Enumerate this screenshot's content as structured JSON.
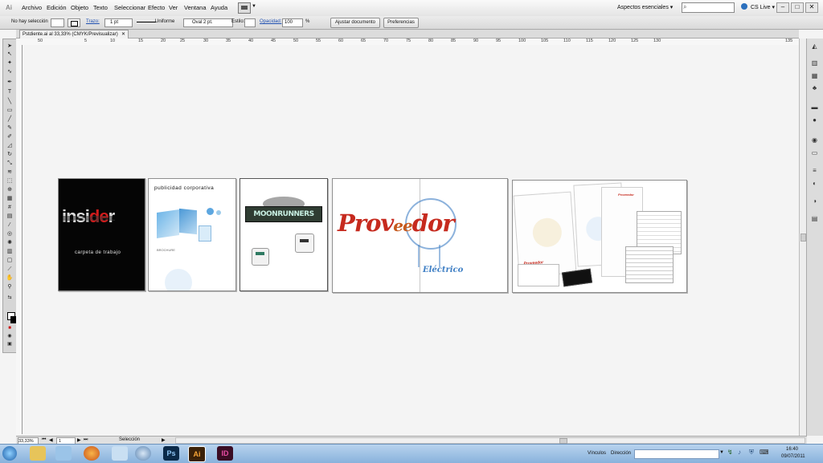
{
  "menubar": {
    "app_logo": "Ai",
    "menus": [
      "Archivo",
      "Edición",
      "Objeto",
      "Texto",
      "Seleccionar",
      "Efecto",
      "Ver",
      "Ventana",
      "Ayuda"
    ],
    "workspace": "Aspectos esenciales ▾",
    "search_placeholder": "",
    "cslive": "CS Live ▾",
    "window_controls": [
      "–",
      "□",
      "✕"
    ]
  },
  "controlbar": {
    "selection": "No hay selección",
    "stroke_label": "Trazo:",
    "stroke_weight": "1 pt",
    "profile": "Uniforme",
    "brush": "Oval 2 pt.",
    "style_label": "Estilo:",
    "opacity_label": "Opacidad:",
    "opacity_value": "100",
    "percent": "%",
    "doc_setup_button": "Ajustar documento",
    "prefs_button": "Preferencias"
  },
  "document_tab": {
    "title": "Pstdiente.ai al 33,33% (CMYK/Previsualizar)",
    "close": "✕"
  },
  "ruler": {
    "ticks": [
      "50",
      "5",
      "10",
      "15",
      "20",
      "25",
      "30",
      "35",
      "40",
      "45",
      "50",
      "55",
      "60",
      "65",
      "70",
      "75",
      "80",
      "85",
      "90",
      "95",
      "100",
      "105",
      "110",
      "115",
      "120",
      "125",
      "130",
      "135"
    ]
  },
  "artboards": {
    "insider": {
      "word_a": "insi",
      "word_b": "de",
      "word_c": "r",
      "caption": "carpeta de trabajo"
    },
    "publicidad": {
      "title": "publicidad corporativa",
      "small": "BROCHURE"
    },
    "moonrunners": {
      "logo": "MOONRUNNERS"
    },
    "proveedor": {
      "word_a": "Prov",
      "word_b": "ee",
      "word_c": "dor",
      "subtitle": "Eléctrico"
    },
    "stationery": {
      "brand": "Proveedor"
    }
  },
  "statusbar": {
    "zoom": "33,33%",
    "page": "1",
    "tool": "Selección"
  },
  "taskbar": {
    "links_label": "Vínculos",
    "address_label": "Dirección",
    "time": "16:40",
    "date": "09/07/2011",
    "apps": [
      "Ps",
      "Ai",
      "ID"
    ]
  },
  "colors": {
    "accent_blue": "#1e4fb0",
    "proveedor_red": "#c62a1e",
    "bulb_blue": "#3f7fc4"
  }
}
